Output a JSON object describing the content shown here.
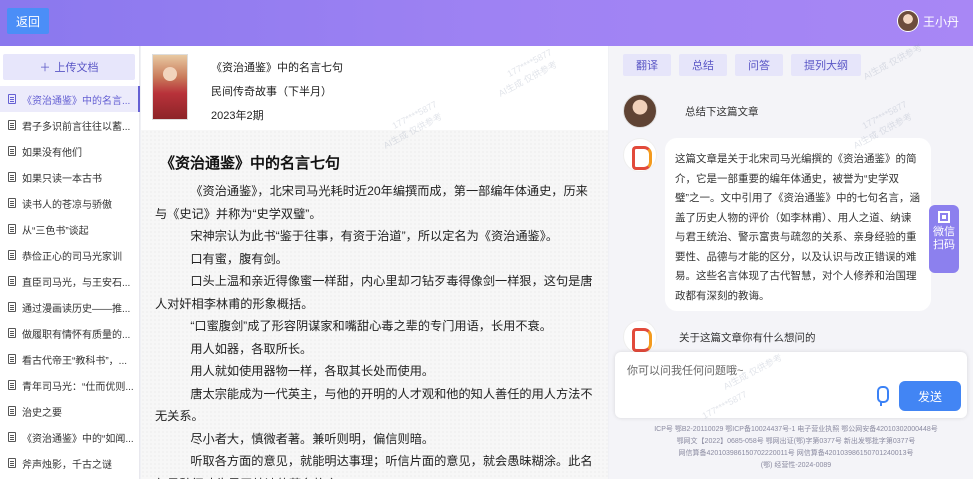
{
  "header": {
    "back_label": "返回",
    "user_name": "王小丹"
  },
  "sidebar": {
    "upload_label": "上传文档",
    "items": [
      {
        "label": "《资治通鉴》中的名言..."
      },
      {
        "label": "君子多识前言往往以蓄..."
      },
      {
        "label": "如果没有他们"
      },
      {
        "label": "如果只读一本古书"
      },
      {
        "label": "读书人的苍凉与骄傲"
      },
      {
        "label": "从“三色书”谈起"
      },
      {
        "label": "恭俭正心的司马光家训"
      },
      {
        "label": "直臣司马光，与王安石..."
      },
      {
        "label": "通过漫画读历史——推..."
      },
      {
        "label": "做履职有情怀有质量的..."
      },
      {
        "label": "看古代帝王“教科书”，..."
      },
      {
        "label": "青年司马光：“仕而优则..."
      },
      {
        "label": "治史之要"
      },
      {
        "label": "《资治通鉴》中的“如闻..."
      },
      {
        "label": "斧声烛影，千古之谜"
      }
    ]
  },
  "article": {
    "meta_title": "《资治通鉴》中的名言七句",
    "meta_source": "民间传奇故事（下半月）",
    "meta_issue": "2023年2期",
    "title": "《资治通鉴》中的名言七句",
    "paragraphs": [
      "《资治通鉴》，北宋司马光耗时近20年编撰而成，第一部编年体通史，历来与《史记》并称为“史学双璧”。",
      "宋神宗认为此书“鉴于往事，有资于治道”，所以定名为《资治通鉴》。",
      "口有蜜，腹有剑。",
      "口头上温和亲近得像蜜一样甜，内心里却刁钻歹毒得像剑一样狠，这句是唐人对奸相李林甫的形象概括。",
      "“口蜜腹剑”成了形容阴谋家和嘴甜心毒之辈的专门用语，长用不衰。",
      "用人如器，各取所长。",
      "用人就如使用器物一样，各取其长处而使用。",
      "唐太宗能成为一代英主，与他的开明的人才观和他的知人善任的用人方法不无关系。",
      "尽小者大，慎微者著。兼听则明，偏信则暗。",
      "听取各方面的意见，就能明达事理；听信片面的意见，就会愚昧糊涂。此名句是魏征劝告君王纳谏的著名格言。"
    ]
  },
  "chat": {
    "tabs": [
      {
        "label": "翻译"
      },
      {
        "label": "总结"
      },
      {
        "label": "问答"
      },
      {
        "label": "提列大纲"
      }
    ],
    "user_msg_1": "总结下这篇文章",
    "bot_reply": "这篇文章是关于北宋司马光编撰的《资治通鉴》的简介，它是一部重要的编年体通史，被誉为“史学双璧”之一。文中引用了《资治通鉴》中的七句名言，涵盖了历史人物的评价（如李林甫）、用人之道、纳谏与君王统治、警示富贵与疏忽的关系、亲身经验的重要性、品德与才能的区分，以及认识与改正错误的难易。这些名言体现了古代智慧，对个人修养和治国理政都有深刻的教诲。",
    "user_msg_2": "关于这篇文章你有什么想问的",
    "input_placeholder": "你可以问我任何问题哦~",
    "send_label": "发送",
    "footer_lines": [
      "ICP号 鄂B2-20110029  鄂ICP备10024437号-1  电子营业执照  鄂公网安备42010302000448号",
      "鄂网文【2022】0685-058号  鄂网出证(鄂)字第0377号  新出发鄂批字第0377号",
      "网信算备420103986150702220011号  网信算备420103986150701240013号",
      "(鄂) 经营性-2024-0089"
    ]
  },
  "side_float": {
    "label_1": "微信",
    "label_2": "扫码"
  },
  "watermark": {
    "text_1": "177****5877",
    "text_2": "AI生成 仅供参考"
  }
}
